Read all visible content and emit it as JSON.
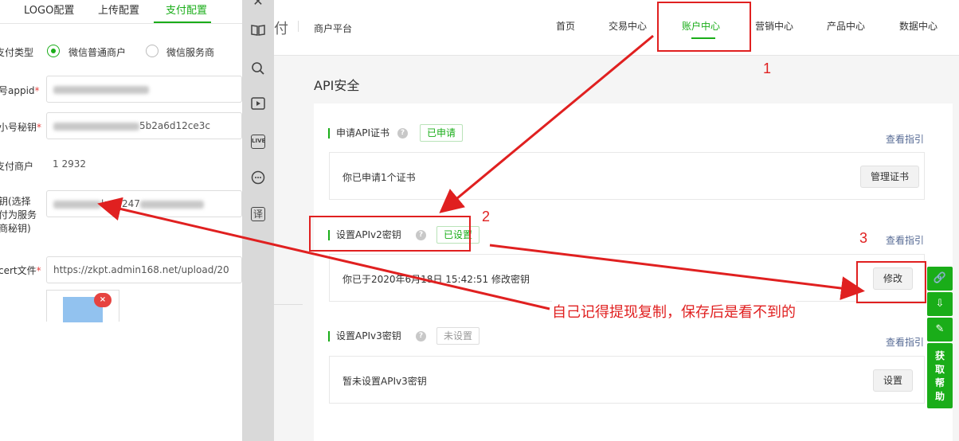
{
  "left": {
    "tabs": [
      "LOGO配置",
      "上传配置",
      "支付配置"
    ],
    "active_tab": "支付配置",
    "pay_type_label": "支付类型",
    "radio_options": [
      "微信普通商户",
      "微信服务商"
    ],
    "fields": [
      {
        "label": "号appid",
        "required": true,
        "value": ""
      },
      {
        "label": "小号秘钥",
        "required": true,
        "value": "5b2a6d12ce3c"
      },
      {
        "label": "支付商户",
        "required": false,
        "value": "1      2932"
      },
      {
        "label": "钥(选择\n付为服务\n商秘钥)",
        "required": false,
        "value": "k      d9247"
      },
      {
        "label": "cert文件",
        "required": true,
        "value": "https://zkpt.admin168.net/upload/20"
      }
    ],
    "upload_delete": "×"
  },
  "toolbar": {
    "icons": [
      "close-icon",
      "book-icon",
      "search-icon",
      "video-icon",
      "live-icon",
      "chat-icon",
      "translate-icon"
    ],
    "live_text": "LIVE",
    "translate_text": "译"
  },
  "nav": {
    "brand_fragment": "付",
    "platform": "商户平台",
    "items": [
      "首页",
      "交易中心",
      "账户中心",
      "营销中心",
      "产品中心",
      "数据中心"
    ],
    "active": "账户中心"
  },
  "content": {
    "title": "API安全",
    "guide_link": "查看指引",
    "sections": [
      {
        "title": "申请API证书",
        "badge": "已申请",
        "badge_state": "green",
        "desc": "你已申请1个证书",
        "button": "管理证书"
      },
      {
        "title": "设置APIv2密钥",
        "badge": "已设置",
        "badge_state": "green",
        "desc": "你已于2020年6月18日 15:42:51 修改密钥",
        "button": "修改"
      },
      {
        "title": "设置APIv3密钥",
        "badge": "未设置",
        "badge_state": "gray",
        "desc": "暂未设置APIv3密钥",
        "button": "设置"
      }
    ]
  },
  "float": {
    "help_label": "获取帮助"
  },
  "annotations": {
    "numbers": [
      "1",
      "2",
      "3"
    ],
    "note": "自己记得提现复制，保存后是看不到的",
    "color": "#e02020"
  },
  "colors": {
    "accent": "#1aad19",
    "link": "#576b95"
  }
}
